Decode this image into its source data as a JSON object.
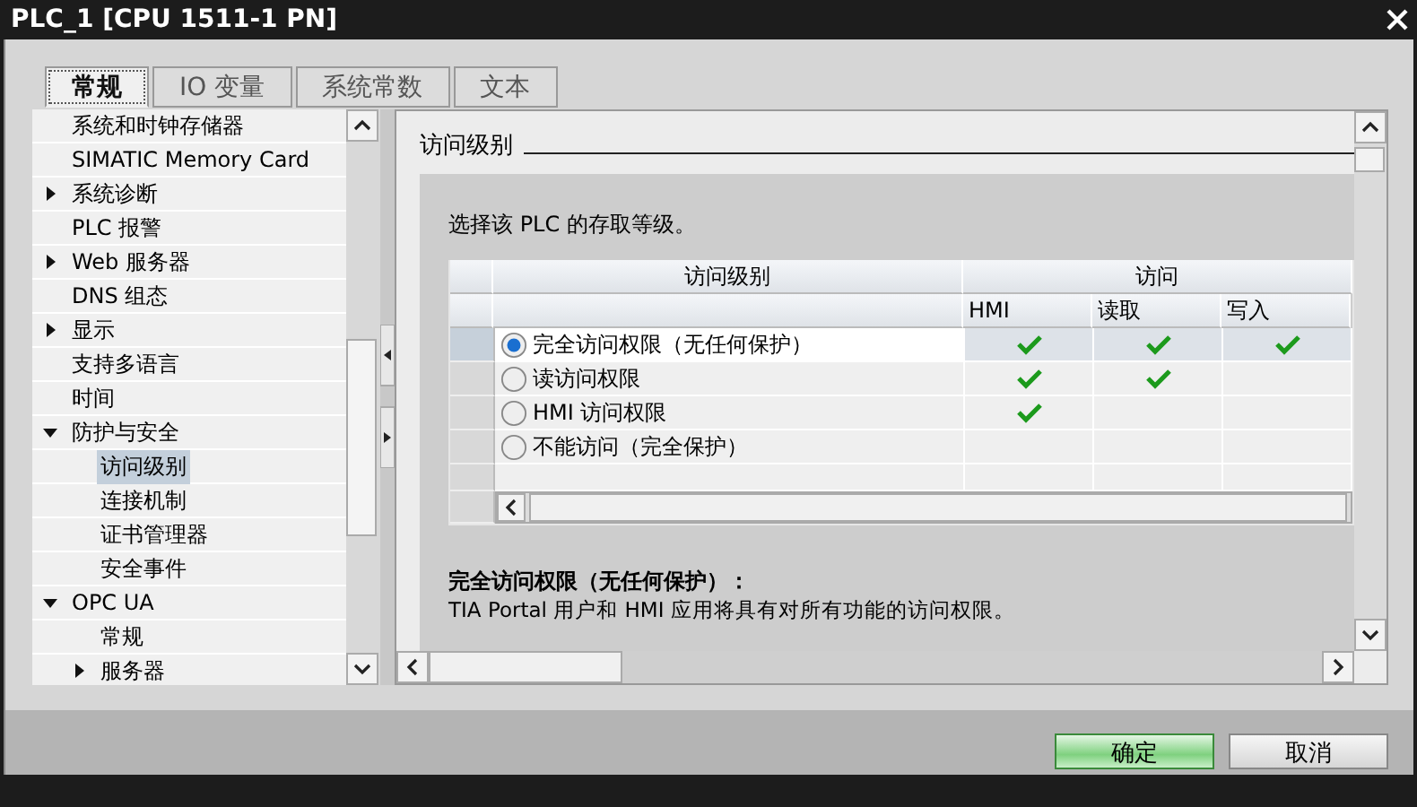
{
  "window": {
    "title": "PLC_1 [CPU 1511-1 PN]"
  },
  "tabs": [
    {
      "label": "常规",
      "selected": true
    },
    {
      "label": "IO 变量",
      "selected": false
    },
    {
      "label": "系统常数",
      "selected": false
    },
    {
      "label": "文本",
      "selected": false
    }
  ],
  "tree": [
    {
      "label": "系统和时钟存储器",
      "kind": "leaf",
      "selected": false
    },
    {
      "label": "SIMATIC Memory Card",
      "kind": "leaf",
      "selected": false
    },
    {
      "label": "系统诊断",
      "kind": "folder",
      "expanded": false,
      "selected": false
    },
    {
      "label": "PLC 报警",
      "kind": "leaf",
      "selected": false
    },
    {
      "label": "Web 服务器",
      "kind": "folder",
      "expanded": false,
      "selected": false
    },
    {
      "label": "DNS 组态",
      "kind": "leaf",
      "selected": false
    },
    {
      "label": "显示",
      "kind": "folder",
      "expanded": false,
      "selected": false
    },
    {
      "label": "支持多语言",
      "kind": "leaf",
      "selected": false
    },
    {
      "label": "时间",
      "kind": "leaf",
      "selected": false
    },
    {
      "label": "防护与安全",
      "kind": "folder",
      "expanded": true,
      "selected": false,
      "children": [
        {
          "label": "访问级别",
          "kind": "leaf",
          "selected": true
        },
        {
          "label": "连接机制",
          "kind": "leaf",
          "selected": false
        },
        {
          "label": "证书管理器",
          "kind": "leaf",
          "selected": false
        },
        {
          "label": "安全事件",
          "kind": "leaf",
          "selected": false
        }
      ]
    },
    {
      "label": "OPC UA",
      "kind": "folder",
      "expanded": true,
      "selected": false,
      "children": [
        {
          "label": "常规",
          "kind": "leaf",
          "selected": false
        },
        {
          "label": "服务器",
          "kind": "folder",
          "expanded": false,
          "selected": false
        }
      ]
    }
  ],
  "section": {
    "title": "访问级别",
    "intro": "选择该 PLC 的存取等级。"
  },
  "access_table": {
    "group_headers": [
      "访问级别",
      "访问"
    ],
    "columns": [
      "HMI",
      "读取",
      "写入"
    ],
    "rows": [
      {
        "label": "完全访问权限（无任何保护）",
        "selected": true,
        "hmi": true,
        "read": true,
        "write": true
      },
      {
        "label": "读访问权限",
        "selected": false,
        "hmi": true,
        "read": true,
        "write": false
      },
      {
        "label": "HMI 访问权限",
        "selected": false,
        "hmi": true,
        "read": false,
        "write": false
      },
      {
        "label": "不能访问（完全保护）",
        "selected": false,
        "hmi": false,
        "read": false,
        "write": false
      }
    ]
  },
  "description": {
    "title": "完全访问权限（无任何保护）：",
    "text": "TIA Portal 用户和 HMI 应用将具有对所有功能的访问权限。"
  },
  "buttons": [
    {
      "label": "确定",
      "kind": "primary"
    },
    {
      "label": "取消",
      "kind": "normal"
    }
  ]
}
